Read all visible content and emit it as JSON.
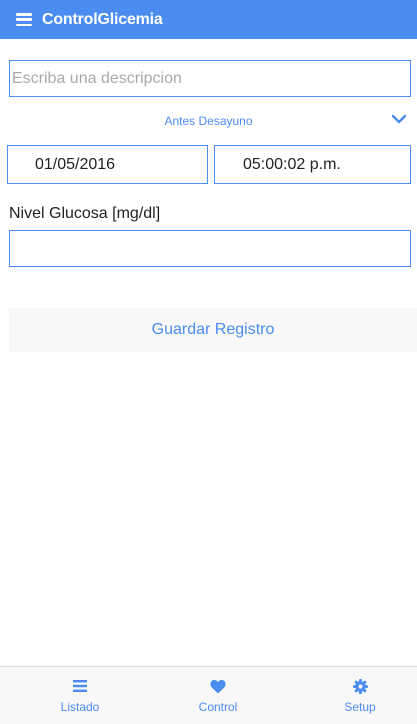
{
  "app": {
    "title": "ControlGlicemia"
  },
  "form": {
    "description_placeholder": "Escriba una descripcion",
    "description_value": "",
    "meal_selected": "Antes Desayuno",
    "date": "01/05/2016",
    "time": "05:00:02 p.m.",
    "glucose_label": "Nivel Glucosa [mg/dl]",
    "glucose_value": "",
    "save_label": "Guardar Registro"
  },
  "tabs": [
    {
      "label": "Listado",
      "icon": "list-icon"
    },
    {
      "label": "Control",
      "icon": "heart-icon"
    },
    {
      "label": "Setup",
      "icon": "gear-icon"
    }
  ],
  "colors": {
    "accent": "#4a8cf0",
    "tabbar_bg": "#f8f8f8"
  }
}
